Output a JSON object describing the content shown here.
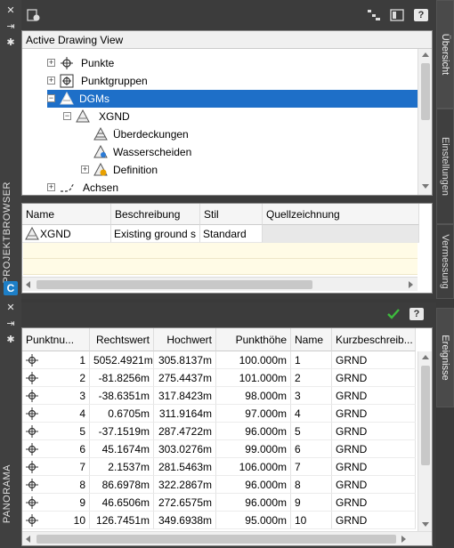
{
  "top_palette": {
    "vertical_title": "PROJEKTBROWSER",
    "tree_header": "Active Drawing View",
    "tree_items": [
      {
        "label": "Punkte",
        "icon": "point-node-icon"
      },
      {
        "label": "Punktgruppen",
        "icon": "point-group-icon"
      },
      {
        "label": "DGMs",
        "icon": "surface-icon"
      },
      {
        "label": "XGND",
        "icon": "surface-icon"
      },
      {
        "label": "Überdeckungen",
        "icon": "overlap-icon"
      },
      {
        "label": "Wasserscheiden",
        "icon": "watershed-icon"
      },
      {
        "label": "Definition",
        "icon": "definition-icon"
      },
      {
        "label": "Achsen",
        "icon": "alignment-icon"
      }
    ],
    "grid_columns": [
      "Name",
      "Beschreibung",
      "Stil",
      "Quellzeichnung"
    ],
    "grid_rows": [
      {
        "name": "XGND",
        "beschreibung": "Existing ground s",
        "stil": "Standard",
        "quell": ""
      }
    ],
    "tabs": [
      "Übersicht",
      "Einstellungen",
      "Vermessung"
    ]
  },
  "bottom_palette": {
    "vertical_title": "PANORAMA",
    "tab": "Ereignisse",
    "columns": [
      "Punktnu...",
      "Rechtswert",
      "Hochwert",
      "Punkthöhe",
      "Name",
      "Kurzbeschreib..."
    ],
    "rows": [
      {
        "nr": "1",
        "rechts": "5052.4921m",
        "hoch": "305.8137m",
        "hoehe": "100.000m",
        "name": "1",
        "kurz": "GRND"
      },
      {
        "nr": "2",
        "rechts": "-81.8256m",
        "hoch": "275.4437m",
        "hoehe": "101.000m",
        "name": "2",
        "kurz": "GRND"
      },
      {
        "nr": "3",
        "rechts": "-38.6351m",
        "hoch": "317.8423m",
        "hoehe": "98.000m",
        "name": "3",
        "kurz": "GRND"
      },
      {
        "nr": "4",
        "rechts": "0.6705m",
        "hoch": "311.9164m",
        "hoehe": "97.000m",
        "name": "4",
        "kurz": "GRND"
      },
      {
        "nr": "5",
        "rechts": "-37.1519m",
        "hoch": "287.4722m",
        "hoehe": "96.000m",
        "name": "5",
        "kurz": "GRND"
      },
      {
        "nr": "6",
        "rechts": "45.1674m",
        "hoch": "303.0276m",
        "hoehe": "99.000m",
        "name": "6",
        "kurz": "GRND"
      },
      {
        "nr": "7",
        "rechts": "2.1537m",
        "hoch": "281.5463m",
        "hoehe": "106.000m",
        "name": "7",
        "kurz": "GRND"
      },
      {
        "nr": "8",
        "rechts": "86.6978m",
        "hoch": "322.2867m",
        "hoehe": "96.000m",
        "name": "8",
        "kurz": "GRND"
      },
      {
        "nr": "9",
        "rechts": "46.6506m",
        "hoch": "272.6575m",
        "hoehe": "96.000m",
        "name": "9",
        "kurz": "GRND"
      },
      {
        "nr": "10",
        "rechts": "126.7451m",
        "hoch": "349.6938m",
        "hoehe": "95.000m",
        "name": "10",
        "kurz": "GRND"
      }
    ]
  },
  "colors": {
    "selection": "#1e6fc8",
    "check": "#3dbb3d"
  }
}
